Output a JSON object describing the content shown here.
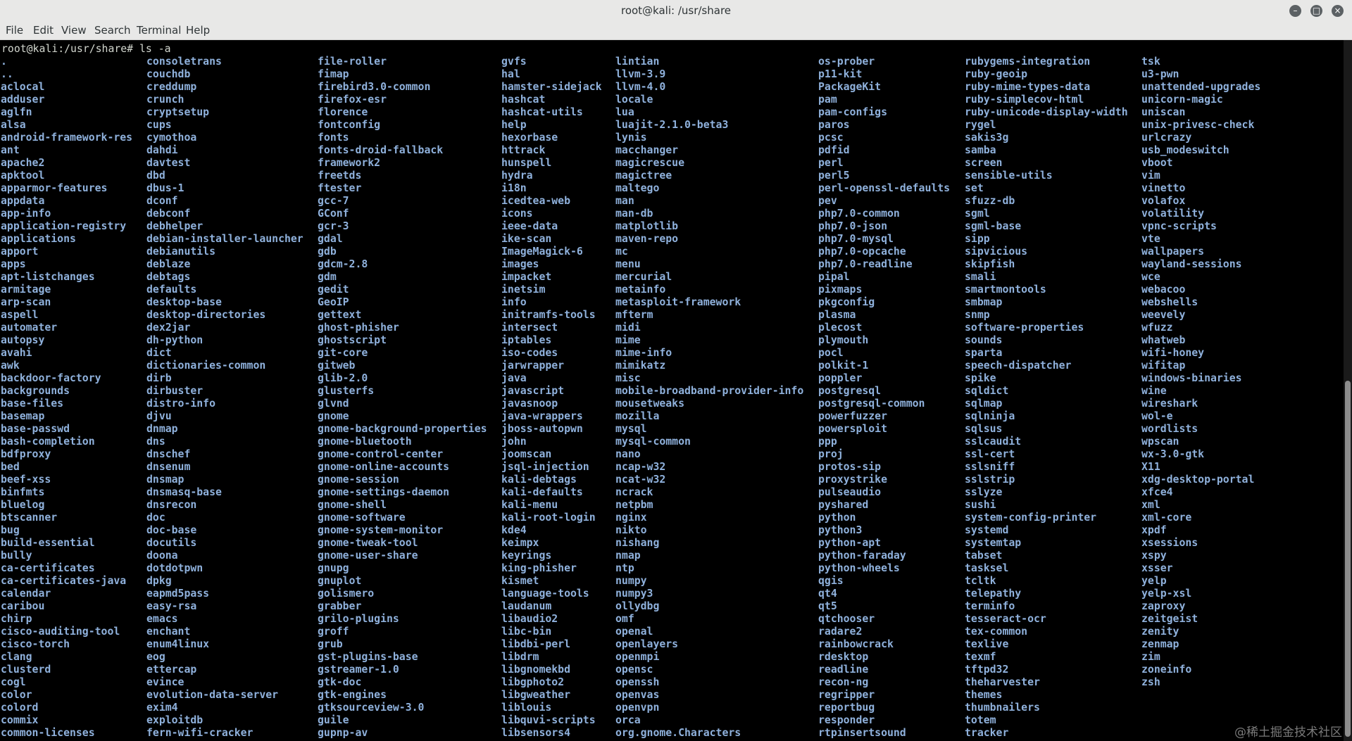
{
  "window": {
    "title": "root@kali: /usr/share",
    "minimize": "–",
    "maximize": "□",
    "close": "×"
  },
  "menu": [
    "File",
    "Edit",
    "View",
    "Search",
    "Terminal",
    "Help"
  ],
  "terminal": {
    "prompt_user": "root@kali",
    "prompt_path": ":/usr/share#",
    "command": " ls -a",
    "columns": [
      [
        ".",
        "..",
        "aclocal",
        "adduser",
        "aglfn",
        "alsa",
        "android-framework-res",
        "ant",
        "apache2",
        "apktool",
        "apparmor-features",
        "appdata",
        "app-info",
        "application-registry",
        "applications",
        "apport",
        "apps",
        "apt-listchanges",
        "armitage",
        "arp-scan",
        "aspell",
        "automater",
        "autopsy",
        "avahi",
        "awk",
        "backdoor-factory",
        "backgrounds",
        "base-files",
        "basemap",
        "base-passwd",
        "bash-completion",
        "bdfproxy",
        "bed",
        "beef-xss",
        "binfmts",
        "bluelog",
        "btscanner",
        "bug",
        "build-essential",
        "bully",
        "ca-certificates",
        "ca-certificates-java",
        "calendar",
        "caribou",
        "chirp",
        "cisco-auditing-tool",
        "cisco-torch",
        "clang",
        "clusterd",
        "cogl",
        "color",
        "colord",
        "commix",
        "common-licenses"
      ],
      [
        "consoletrans",
        "couchdb",
        "creddump",
        "crunch",
        "cryptsetup",
        "cups",
        "cymothoa",
        "dahdi",
        "davtest",
        "dbd",
        "dbus-1",
        "dconf",
        "debconf",
        "debhelper",
        "debian-installer-launcher",
        "debianutils",
        "deblaze",
        "debtags",
        "defaults",
        "desktop-base",
        "desktop-directories",
        "dex2jar",
        "dh-python",
        "dict",
        "dictionaries-common",
        "dirb",
        "dirbuster",
        "distro-info",
        "djvu",
        "dnmap",
        "dns",
        "dnschef",
        "dnsenum",
        "dnsmap",
        "dnsmasq-base",
        "dnsrecon",
        "doc",
        "doc-base",
        "docutils",
        "doona",
        "dotdotpwn",
        "dpkg",
        "eapmd5pass",
        "easy-rsa",
        "emacs",
        "enchant",
        "enum4linux",
        "eog",
        "ettercap",
        "evince",
        "evolution-data-server",
        "exim4",
        "exploitdb",
        "fern-wifi-cracker"
      ],
      [
        "file-roller",
        "fimap",
        "firebird3.0-common",
        "firefox-esr",
        "florence",
        "fontconfig",
        "fonts",
        "fonts-droid-fallback",
        "framework2",
        "freetds",
        "ftester",
        "gcc-7",
        "GConf",
        "gcr-3",
        "gdal",
        "gdb",
        "gdcm-2.8",
        "gdm",
        "gedit",
        "GeoIP",
        "gettext",
        "ghost-phisher",
        "ghostscript",
        "git-core",
        "gitweb",
        "glib-2.0",
        "glusterfs",
        "glvnd",
        "gnome",
        "gnome-background-properties",
        "gnome-bluetooth",
        "gnome-control-center",
        "gnome-online-accounts",
        "gnome-session",
        "gnome-settings-daemon",
        "gnome-shell",
        "gnome-software",
        "gnome-system-monitor",
        "gnome-tweak-tool",
        "gnome-user-share",
        "gnupg",
        "gnuplot",
        "golismero",
        "grabber",
        "grilo-plugins",
        "groff",
        "grub",
        "gst-plugins-base",
        "gstreamer-1.0",
        "gtk-doc",
        "gtk-engines",
        "gtksourceview-3.0",
        "guile",
        "gupnp-av"
      ],
      [
        "gvfs",
        "hal",
        "hamster-sidejack",
        "hashcat",
        "hashcat-utils",
        "help",
        "hexorbase",
        "httrack",
        "hunspell",
        "hydra",
        "i18n",
        "icedtea-web",
        "icons",
        "ieee-data",
        "ike-scan",
        "ImageMagick-6",
        "images",
        "impacket",
        "inetsim",
        "info",
        "initramfs-tools",
        "intersect",
        "iptables",
        "iso-codes",
        "jarwrapper",
        "java",
        "javascript",
        "javasnoop",
        "java-wrappers",
        "jboss-autopwn",
        "john",
        "joomscan",
        "jsql-injection",
        "kali-debtags",
        "kali-defaults",
        "kali-menu",
        "kali-root-login",
        "kde4",
        "keimpx",
        "keyrings",
        "king-phisher",
        "kismet",
        "language-tools",
        "laudanum",
        "libaudio2",
        "libc-bin",
        "libdbi-perl",
        "libdrm",
        "libgnomekbd",
        "libgphoto2",
        "libgweather",
        "liblouis",
        "libquvi-scripts",
        "libsensors4"
      ],
      [
        "lintian",
        "llvm-3.9",
        "llvm-4.0",
        "locale",
        "lua",
        "luajit-2.1.0-beta3",
        "lynis",
        "macchanger",
        "magicrescue",
        "magictree",
        "maltego",
        "man",
        "man-db",
        "matplotlib",
        "maven-repo",
        "mc",
        "menu",
        "mercurial",
        "metainfo",
        "metasploit-framework",
        "mfterm",
        "midi",
        "mime",
        "mime-info",
        "mimikatz",
        "misc",
        "mobile-broadband-provider-info",
        "mousetweaks",
        "mozilla",
        "mysql",
        "mysql-common",
        "nano",
        "ncap-w32",
        "ncat-w32",
        "ncrack",
        "netpbm",
        "nginx",
        "nikto",
        "nishang",
        "nmap",
        "ntp",
        "numpy",
        "numpy3",
        "ollydbg",
        "omf",
        "openal",
        "openlayers",
        "openmpi",
        "opensc",
        "openssh",
        "openvas",
        "openvpn",
        "orca",
        "org.gnome.Characters"
      ],
      [
        "os-prober",
        "p11-kit",
        "PackageKit",
        "pam",
        "pam-configs",
        "paros",
        "pcsc",
        "pdfid",
        "perl",
        "perl5",
        "perl-openssl-defaults",
        "pev",
        "php7.0-common",
        "php7.0-json",
        "php7.0-mysql",
        "php7.0-opcache",
        "php7.0-readline",
        "pipal",
        "pixmaps",
        "pkgconfig",
        "plasma",
        "plecost",
        "plymouth",
        "pocl",
        "polkit-1",
        "poppler",
        "postgresql",
        "postgresql-common",
        "powerfuzzer",
        "powersploit",
        "ppp",
        "proj",
        "protos-sip",
        "proxystrike",
        "pulseaudio",
        "pyshared",
        "python",
        "python3",
        "python-apt",
        "python-faraday",
        "python-wheels",
        "qgis",
        "qt4",
        "qt5",
        "qtchooser",
        "radare2",
        "rainbowcrack",
        "rdesktop",
        "readline",
        "recon-ng",
        "regripper",
        "reportbug",
        "responder",
        "rtpinsertsound"
      ],
      [
        "rubygems-integration",
        "ruby-geoip",
        "ruby-mime-types-data",
        "ruby-simplecov-html",
        "ruby-unicode-display-width",
        "rygel",
        "sakis3g",
        "samba",
        "screen",
        "sensible-utils",
        "set",
        "sfuzz-db",
        "sgml",
        "sgml-base",
        "sipp",
        "sipvicious",
        "skipfish",
        "smali",
        "smartmontools",
        "smbmap",
        "snmp",
        "software-properties",
        "sounds",
        "sparta",
        "speech-dispatcher",
        "spike",
        "sqldict",
        "sqlmap",
        "sqlninja",
        "sqlsus",
        "sslcaudit",
        "ssl-cert",
        "sslsniff",
        "sslstrip",
        "sslyze",
        "sushi",
        "system-config-printer",
        "systemd",
        "systemtap",
        "tabset",
        "tasksel",
        "tcltk",
        "telepathy",
        "terminfo",
        "tesseract-ocr",
        "tex-common",
        "texlive",
        "texmf",
        "tftpd32",
        "theharvester",
        "themes",
        "thumbnailers",
        "totem",
        "tracker"
      ],
      [
        "tsk",
        "u3-pwn",
        "unattended-upgrades",
        "unicorn-magic",
        "uniscan",
        "unix-privesc-check",
        "urlcrazy",
        "usb_modeswitch",
        "vboot",
        "vim",
        "vinetto",
        "volafox",
        "volatility",
        "vpnc-scripts",
        "vte",
        "wallpapers",
        "wayland-sessions",
        "wce",
        "webacoo",
        "webshells",
        "weevely",
        "wfuzz",
        "whatweb",
        "wifi-honey",
        "wifitap",
        "windows-binaries",
        "wine",
        "wireshark",
        "wol-e",
        "wordlists",
        "wpscan",
        "wx-3.0-gtk",
        "X11",
        "xdg-desktop-portal",
        "xfce4",
        "xml",
        "xml-core",
        "xpdf",
        "xsessions",
        "xspy",
        "xsser",
        "yelp",
        "yelp-xsl",
        "zaproxy",
        "zeitgeist",
        "zenity",
        "zenmap",
        "zim",
        "zoneinfo",
        "zsh"
      ]
    ]
  },
  "watermark": "@稀土掘金技术社区",
  "colors": {
    "directory": "#8fb1dc",
    "prompt": "#d3d7cf",
    "background": "#000000",
    "chrome": "#e8e8e7"
  }
}
